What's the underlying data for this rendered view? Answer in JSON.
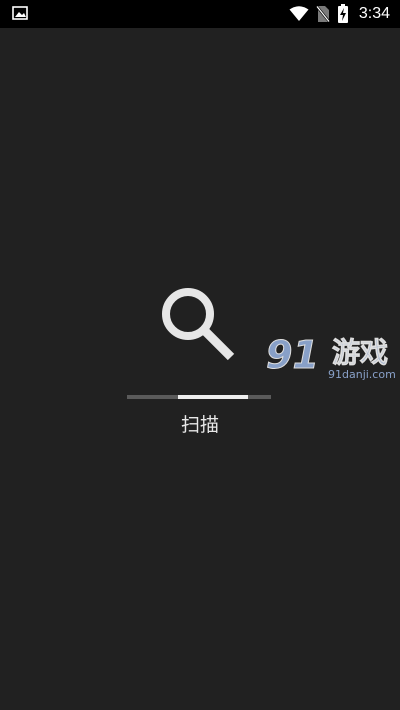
{
  "status_bar": {
    "time": "3:34",
    "icons": [
      "gallery-icon",
      "wifi-icon",
      "no-sim-icon",
      "battery-charging-icon"
    ]
  },
  "scan": {
    "label": "扫描",
    "progress": 0.5,
    "icon": "search-icon"
  },
  "watermark": {
    "text": "91游戏",
    "site": "91danji.com"
  },
  "colors": {
    "background": "#212121",
    "status_bar": "#000000",
    "progress_track": "#5a5a5a",
    "progress_fill": "#eeeeee",
    "watermark": "#9bb7e6"
  }
}
